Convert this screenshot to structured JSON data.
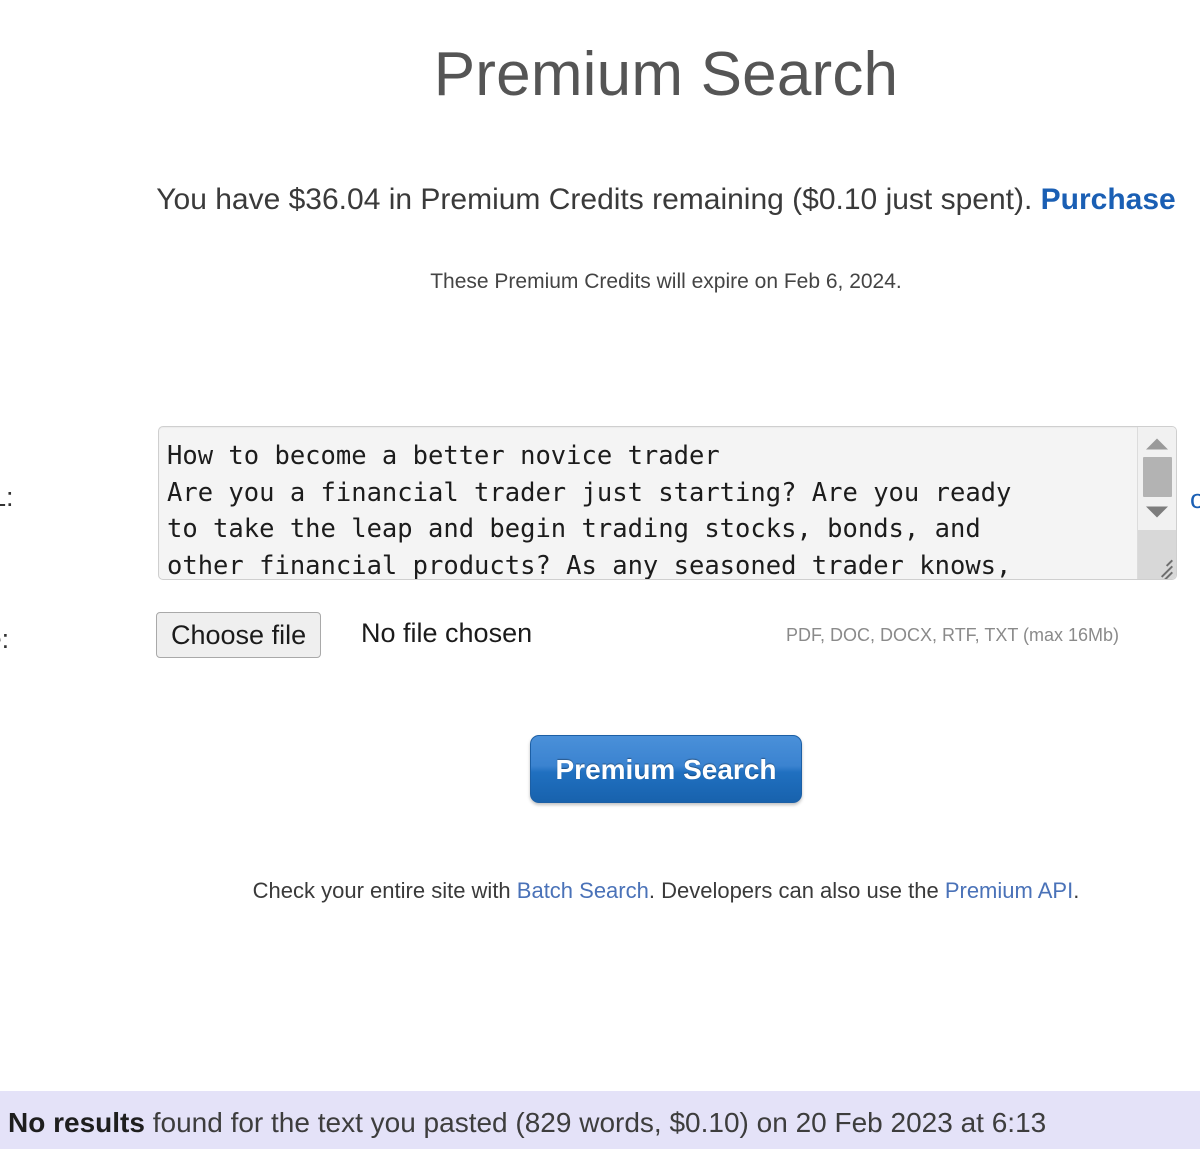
{
  "page": {
    "title": "Premium Search"
  },
  "credits": {
    "prefix": "You have $36.04 in Premium Credits remaining ($0.10 just spent). ",
    "amount_remaining": "$36.04",
    "amount_spent": "$0.10",
    "purchase_link": "Purchase",
    "expiry": "These Premium Credits will expire on Feb 6, 2024.",
    "expiry_date": "Feb 6, 2024"
  },
  "form": {
    "text_label": "xt or URL:",
    "text_label_full": "Paste text or URL:",
    "textarea_value": "How to become a better novice trader\nAre you a financial trader just starting? Are you ready\nto take the leap and begin trading stocks, bonds, and\nother financial products? As any seasoned trader knows,",
    "side_link_clipped": "o",
    "file_label": "oad a file:",
    "file_label_full": "Or upload a file:",
    "choose_file_button": "Choose file",
    "file_status": "No file chosen",
    "file_hint": "PDF, DOC, DOCX, RTF, TXT (max 16Mb)",
    "submit_button": "Premium Search"
  },
  "footer": {
    "before_batch": "Check your entire site with ",
    "batch_link": "Batch Search",
    "between_links": ". Developers can also use the ",
    "api_link": "Premium API",
    "after_api": "."
  },
  "results": {
    "status": "No results",
    "rest": " found for the text you pasted (829 words, $0.10) on 20 Feb 2023 at 6:13",
    "word_count": "829 words",
    "cost": "$0.10",
    "date": "20 Feb 2023",
    "time": "6:13"
  },
  "colors": {
    "link_blue": "#1a5fb4",
    "footer_link": "#4a72b8",
    "button_top": "#4a90d9",
    "button_bottom": "#1862ad",
    "results_bar_bg": "#e4e2f8",
    "title_gray": "#555555"
  }
}
